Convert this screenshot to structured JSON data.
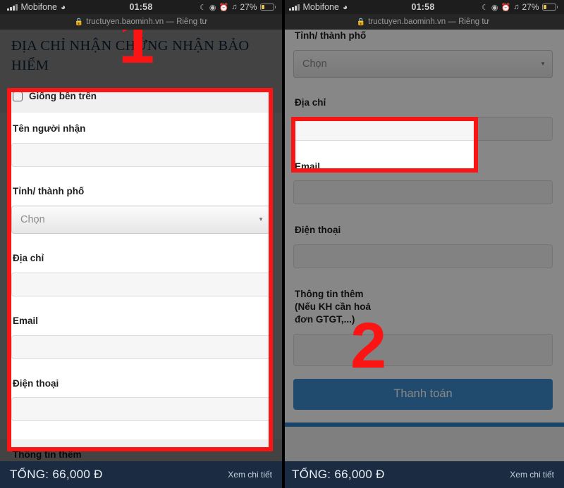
{
  "status_bar": {
    "carrier": "Mobifone",
    "wifi_icon": "wifi-icon",
    "time": "01:58",
    "moon_icon": "moon-icon",
    "alarm_icon": "alarm-icon",
    "lock_rotation_icon": "rotation-lock-icon",
    "headphones_icon": "headphones-icon",
    "battery_percent": "27%"
  },
  "url_bar": {
    "lock_icon": "lock-icon",
    "url_text": "tructuyen.baominh.vn — Riêng tư"
  },
  "left_panel": {
    "page_title": "ĐỊA CHỈ NHẬN CHỨNG NHẬN BẢO HIỂM",
    "same_as_above_label": "Giống bên trên",
    "fields": [
      {
        "label": "Tên người nhận",
        "type": "text",
        "value": ""
      },
      {
        "label": "Tỉnh/ thành phố",
        "type": "select",
        "value": "Chọn"
      },
      {
        "label": "Địa chỉ",
        "type": "text",
        "value": ""
      },
      {
        "label": "Email",
        "type": "text",
        "value": ""
      },
      {
        "label": "Điện thoại",
        "type": "text",
        "value": ""
      }
    ],
    "next_section_label": "Thông tin thêm",
    "annotation_number": "1"
  },
  "right_panel": {
    "partial_top_label": "Tỉnh/ thành phố",
    "fields": [
      {
        "label": "Tỉnh/ thành phố",
        "type": "select",
        "value": "Chọn"
      },
      {
        "label": "Địa chỉ",
        "type": "text",
        "value": ""
      },
      {
        "label": "Email",
        "type": "text",
        "value": ""
      },
      {
        "label": "Điện thoại",
        "type": "text",
        "value": ""
      },
      {
        "label": "Thông tin thêm (Nếu KH cần hoá đơn GTGT,...)",
        "type": "text",
        "value": ""
      }
    ],
    "pay_button_label": "Thanh toán",
    "annotation_number": "2"
  },
  "total_bar": {
    "total_label": "TỔNG: 66,000 Đ",
    "details_link": "Xem chi tiết"
  },
  "colors": {
    "accent_blue": "#3d8fd1",
    "annotation_red": "#fb1414",
    "total_bar_navy": "#1b2c42",
    "title_navy": "#183a5c"
  }
}
